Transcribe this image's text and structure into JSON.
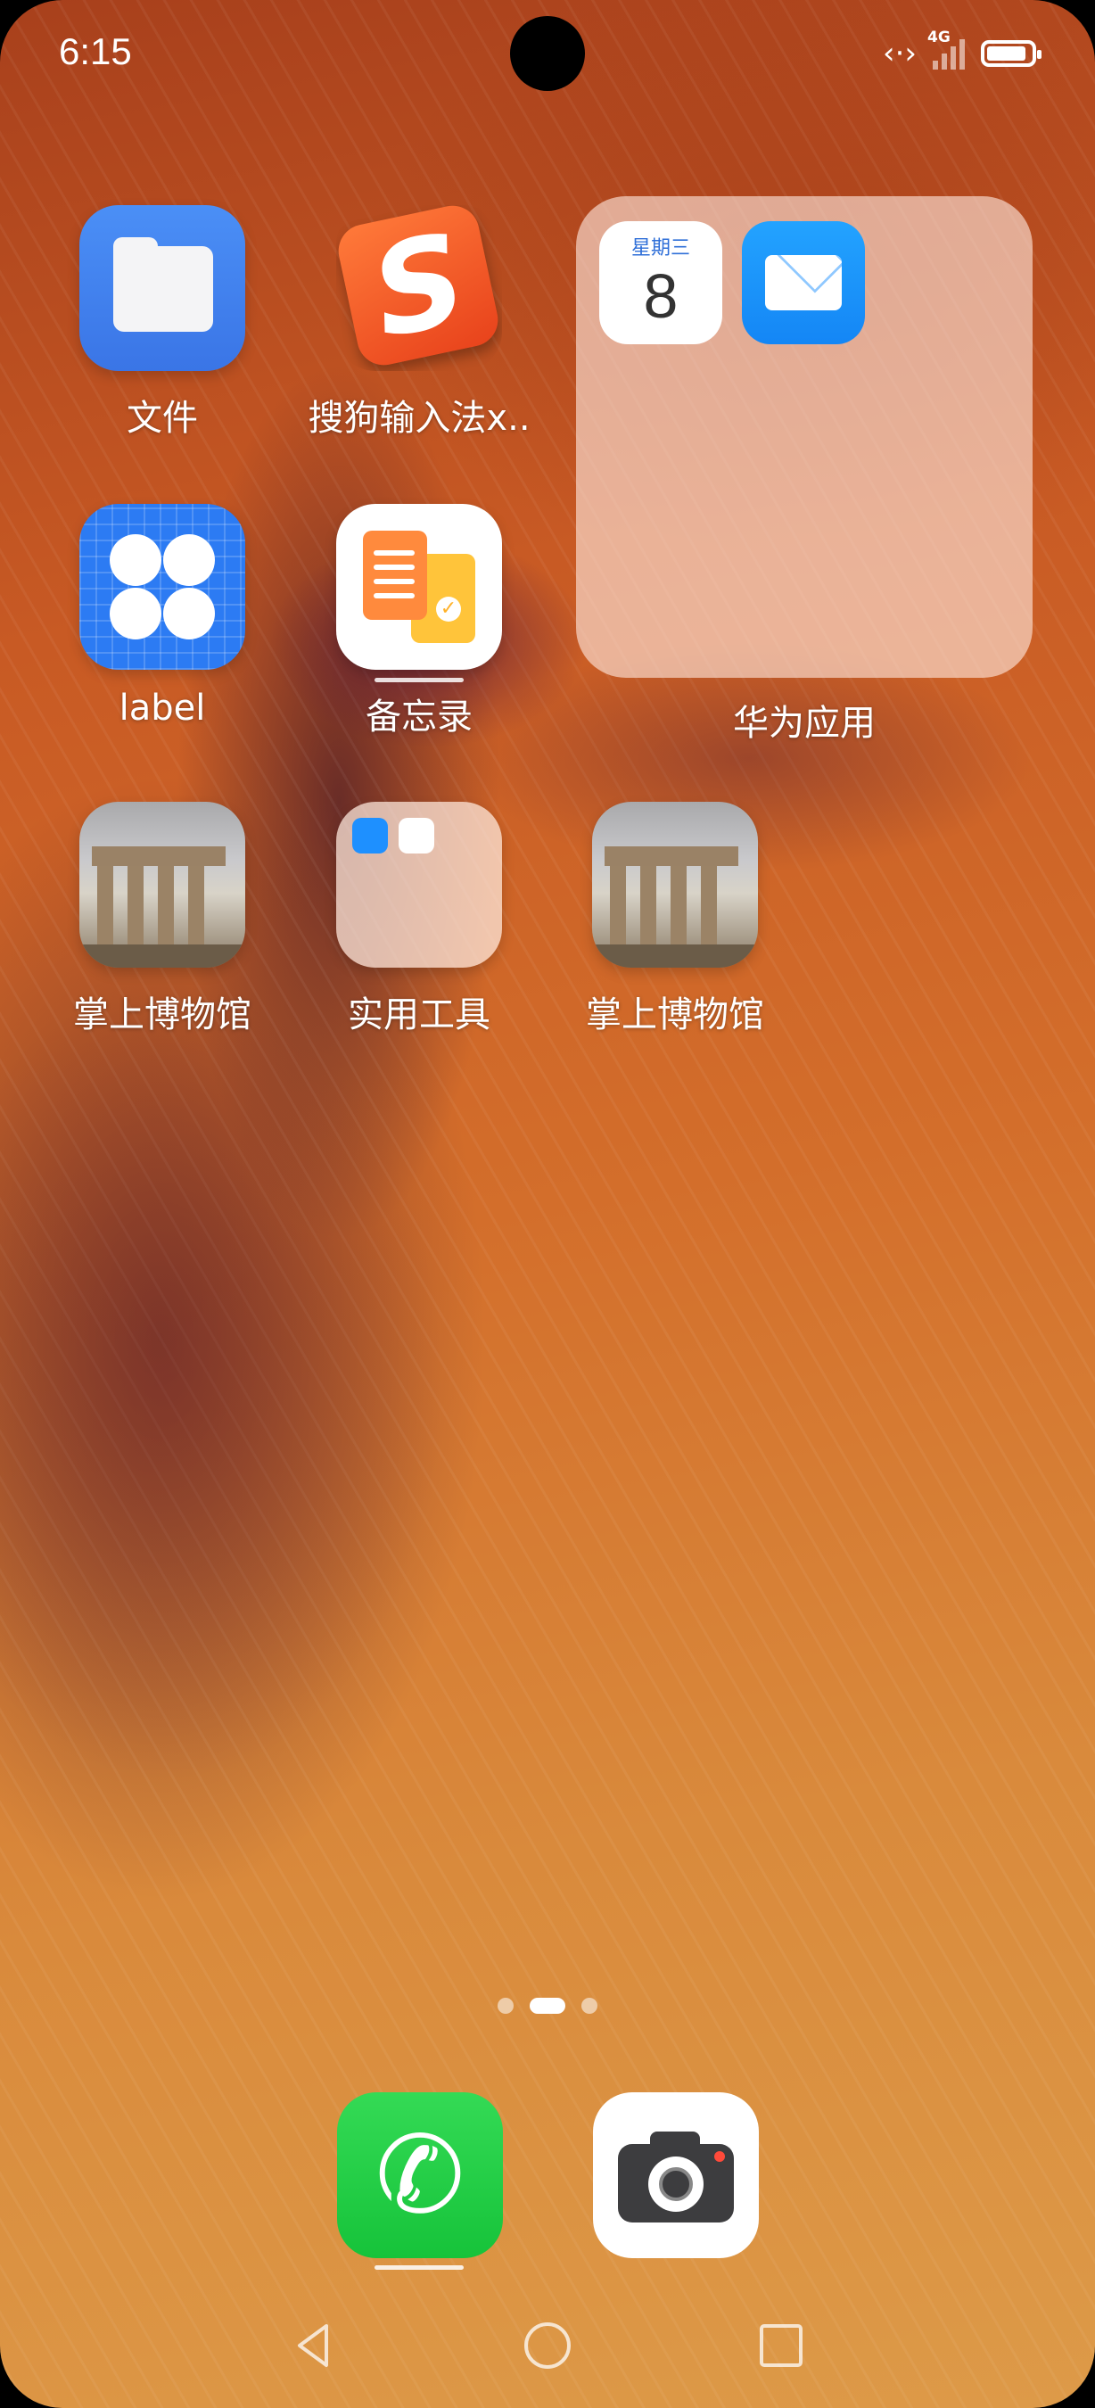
{
  "status_bar": {
    "time": "6:15",
    "network_label": "4G",
    "battery_level": 0.9,
    "icons": [
      "data-transfer-icon",
      "signal-icon",
      "battery-icon"
    ]
  },
  "apps": [
    {
      "label": "文件",
      "icon": "files-folder-icon"
    },
    {
      "label": "搜狗输入法x..",
      "icon": "sogou-input-icon"
    },
    {
      "label": "label",
      "icon": "grid-flower-icon"
    },
    {
      "label": "备忘录",
      "icon": "memo-icon"
    },
    {
      "label": "掌上博物馆",
      "icon": "museum-temple-icon"
    },
    {
      "label": "实用工具",
      "icon": "utilities-folder-icon"
    },
    {
      "label": "掌上博物馆",
      "icon": "museum-temple-icon"
    }
  ],
  "folder": {
    "label": "华为应用",
    "calendar": {
      "weekday": "星期三",
      "day": "8"
    },
    "apps": [
      "calendar-icon",
      "email-icon"
    ]
  },
  "page_indicator": {
    "pages": 3,
    "current": 2
  },
  "dock": [
    {
      "name": "phone",
      "icon": "phone-icon"
    },
    {
      "name": "camera",
      "icon": "camera-icon"
    }
  ],
  "navigation": [
    "back-icon",
    "home-icon",
    "recents-icon"
  ]
}
